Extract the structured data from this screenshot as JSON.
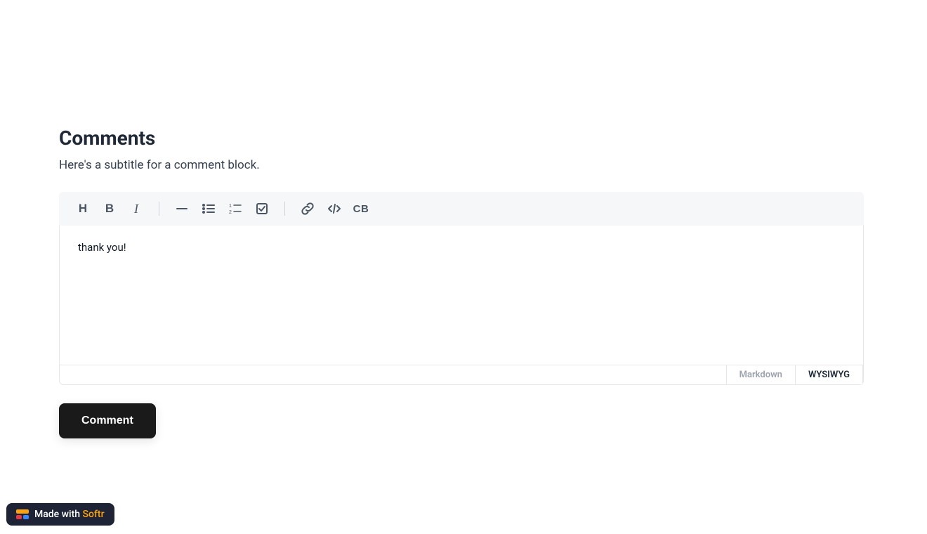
{
  "header": {
    "title": "Comments",
    "subtitle": "Here's a subtitle for a comment block."
  },
  "toolbar": {
    "heading_label": "H",
    "bold_label": "B",
    "italic_label": "I",
    "codeblock_label": "CB"
  },
  "editor": {
    "content": "thank you!"
  },
  "footer": {
    "markdown_label": "Markdown",
    "wysiwyg_label": "WYSIWYG"
  },
  "actions": {
    "comment_button": "Comment"
  },
  "badge": {
    "made_with": "Made with ",
    "softr": "Softr"
  }
}
